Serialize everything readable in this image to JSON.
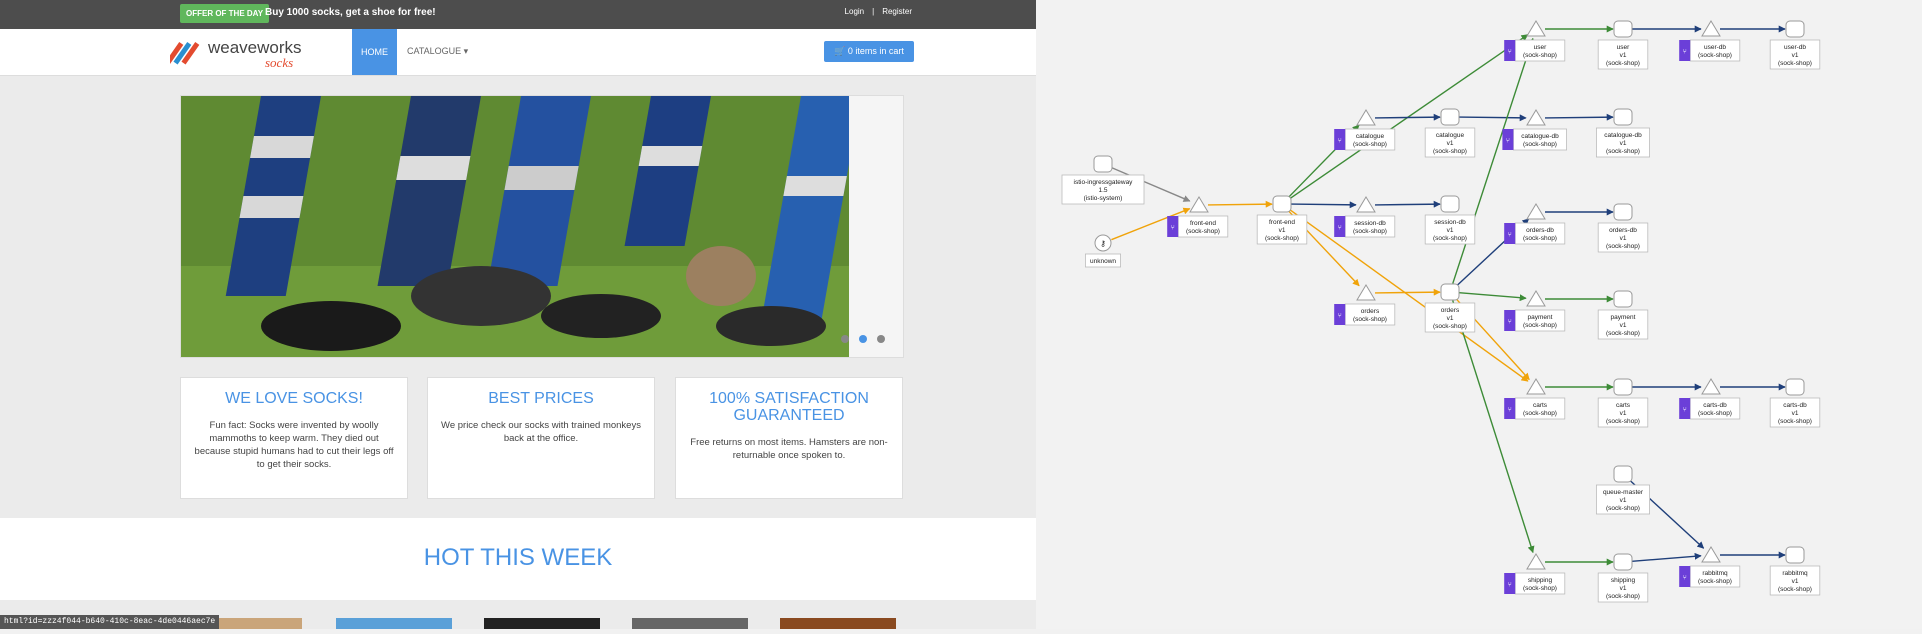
{
  "topbar": {
    "offer_badge": "OFFER OF THE DAY",
    "offer_text": "Buy 1000 socks, get a shoe for free!",
    "login": "Login",
    "sep": "|",
    "register": "Register"
  },
  "navbar": {
    "logo_main": "weaveworks",
    "logo_sub": "socks",
    "home": "HOME",
    "catalogue": "CATALOGUE ▾",
    "cart": "0 items in cart"
  },
  "features": [
    {
      "title": "WE LOVE SOCKS!",
      "text": "Fun fact: Socks were invented by woolly mammoths to keep warm. They died out because stupid humans had to cut their legs off to get their socks."
    },
    {
      "title": "BEST PRICES",
      "text": "We price check our socks with trained monkeys back at the office."
    },
    {
      "title": "100% SATISFACTION GUARANTEED",
      "text": "Free returns on most items. Hamsters are non-returnable once spoken to."
    }
  ],
  "hot": {
    "title": "HOT THIS WEEK"
  },
  "status_url": "html?id=zzz4f044-b640-410c-8eac-4de0446aec7e",
  "graph": {
    "colors": {
      "green": "#3d8b37",
      "orange": "#f0a30a",
      "navy": "#1f3f7a",
      "gray": "#888888",
      "purple": "#6b3fd8"
    },
    "nodes": [
      {
        "id": "gw",
        "type": "workload",
        "label": [
          "istio-ingressgateway",
          "1.5",
          "(istio-system)"
        ]
      },
      {
        "id": "unknown",
        "type": "unknown",
        "label": [
          "unknown"
        ]
      },
      {
        "id": "fe_svc",
        "type": "service",
        "label": [
          "front-end",
          "(sock-shop)"
        ]
      },
      {
        "id": "fe_w",
        "type": "workload",
        "label": [
          "front-end",
          "v1",
          "(sock-shop)"
        ]
      },
      {
        "id": "cat_svc",
        "type": "service",
        "label": [
          "catalogue",
          "(sock-shop)"
        ]
      },
      {
        "id": "cat_w",
        "type": "workload",
        "label": [
          "catalogue",
          "v1",
          "(sock-shop)"
        ]
      },
      {
        "id": "catdb_svc",
        "type": "service",
        "label": [
          "catalogue-db",
          "(sock-shop)"
        ]
      },
      {
        "id": "catdb_w",
        "type": "workload",
        "label": [
          "catalogue-db",
          "v1",
          "(sock-shop)"
        ]
      },
      {
        "id": "sess_svc",
        "type": "service",
        "label": [
          "session-db",
          "(sock-shop)"
        ]
      },
      {
        "id": "sess_w",
        "type": "workload",
        "label": [
          "session-db",
          "v1",
          "(sock-shop)"
        ]
      },
      {
        "id": "user_svc",
        "type": "service",
        "label": [
          "user",
          "(sock-shop)"
        ]
      },
      {
        "id": "user_w",
        "type": "workload",
        "label": [
          "user",
          "v1",
          "(sock-shop)"
        ]
      },
      {
        "id": "userdb_svc",
        "type": "service",
        "label": [
          "user-db",
          "(sock-shop)"
        ]
      },
      {
        "id": "userdb_w",
        "type": "workload",
        "label": [
          "user-db",
          "v1",
          "(sock-shop)"
        ]
      },
      {
        "id": "ord_svc",
        "type": "service",
        "label": [
          "orders",
          "(sock-shop)"
        ]
      },
      {
        "id": "ord_w",
        "type": "workload",
        "label": [
          "orders",
          "v1",
          "(sock-shop)"
        ]
      },
      {
        "id": "orddb_svc",
        "type": "service",
        "label": [
          "orders-db",
          "(sock-shop)"
        ]
      },
      {
        "id": "orddb_w",
        "type": "workload",
        "label": [
          "orders-db",
          "v1",
          "(sock-shop)"
        ]
      },
      {
        "id": "pay_svc",
        "type": "service",
        "label": [
          "payment",
          "(sock-shop)"
        ]
      },
      {
        "id": "pay_w",
        "type": "workload",
        "label": [
          "payment",
          "v1",
          "(sock-shop)"
        ]
      },
      {
        "id": "carts_svc",
        "type": "service",
        "label": [
          "carts",
          "(sock-shop)"
        ]
      },
      {
        "id": "carts_w",
        "type": "workload",
        "label": [
          "carts",
          "v1",
          "(sock-shop)"
        ]
      },
      {
        "id": "cartsdb_svc",
        "type": "service",
        "label": [
          "carts-db",
          "(sock-shop)"
        ]
      },
      {
        "id": "cartsdb_w",
        "type": "workload",
        "label": [
          "carts-db",
          "v1",
          "(sock-shop)"
        ]
      },
      {
        "id": "qm_w",
        "type": "workload",
        "label": [
          "queue-master",
          "v1",
          "(sock-shop)"
        ]
      },
      {
        "id": "ship_svc",
        "type": "service",
        "label": [
          "shipping",
          "(sock-shop)"
        ]
      },
      {
        "id": "ship_w",
        "type": "workload",
        "label": [
          "shipping",
          "v1",
          "(sock-shop)"
        ]
      },
      {
        "id": "rmq_svc",
        "type": "service",
        "label": [
          "rabbitmq",
          "(sock-shop)"
        ]
      },
      {
        "id": "rmq_w",
        "type": "workload",
        "label": [
          "rabbitmq",
          "v1",
          "(sock-shop)"
        ]
      }
    ],
    "edges": [
      {
        "from": "gw",
        "to": "fe_svc",
        "color": "gray"
      },
      {
        "from": "unknown",
        "to": "fe_svc",
        "color": "orange"
      },
      {
        "from": "fe_svc",
        "to": "fe_w",
        "color": "orange"
      },
      {
        "from": "fe_w",
        "to": "cat_svc",
        "color": "green"
      },
      {
        "from": "fe_w",
        "to": "user_svc",
        "color": "green"
      },
      {
        "from": "fe_w",
        "to": "sess_svc",
        "color": "navy"
      },
      {
        "from": "fe_w",
        "to": "ord_svc",
        "color": "orange"
      },
      {
        "from": "fe_w",
        "to": "carts_svc",
        "color": "orange"
      },
      {
        "from": "cat_svc",
        "to": "cat_w",
        "color": "navy"
      },
      {
        "from": "cat_w",
        "to": "catdb_svc",
        "color": "navy"
      },
      {
        "from": "catdb_svc",
        "to": "catdb_w",
        "color": "navy"
      },
      {
        "from": "sess_svc",
        "to": "sess_w",
        "color": "navy"
      },
      {
        "from": "user_svc",
        "to": "user_w",
        "color": "green"
      },
      {
        "from": "user_w",
        "to": "userdb_svc",
        "color": "navy"
      },
      {
        "from": "userdb_svc",
        "to": "userdb_w",
        "color": "navy"
      },
      {
        "from": "ord_svc",
        "to": "ord_w",
        "color": "orange"
      },
      {
        "from": "ord_w",
        "to": "user_svc",
        "color": "green"
      },
      {
        "from": "ord_w",
        "to": "orddb_svc",
        "color": "navy"
      },
      {
        "from": "ord_w",
        "to": "pay_svc",
        "color": "green"
      },
      {
        "from": "ord_w",
        "to": "carts_svc",
        "color": "orange"
      },
      {
        "from": "ord_w",
        "to": "ship_svc",
        "color": "green"
      },
      {
        "from": "orddb_svc",
        "to": "orddb_w",
        "color": "navy"
      },
      {
        "from": "pay_svc",
        "to": "pay_w",
        "color": "green"
      },
      {
        "from": "carts_svc",
        "to": "carts_w",
        "color": "green"
      },
      {
        "from": "carts_w",
        "to": "cartsdb_svc",
        "color": "navy"
      },
      {
        "from": "cartsdb_svc",
        "to": "cartsdb_w",
        "color": "navy"
      },
      {
        "from": "qm_w",
        "to": "rmq_svc",
        "color": "navy"
      },
      {
        "from": "ship_svc",
        "to": "ship_w",
        "color": "green"
      },
      {
        "from": "ship_w",
        "to": "rmq_svc",
        "color": "navy"
      },
      {
        "from": "rmq_svc",
        "to": "rmq_w",
        "color": "navy"
      }
    ]
  }
}
